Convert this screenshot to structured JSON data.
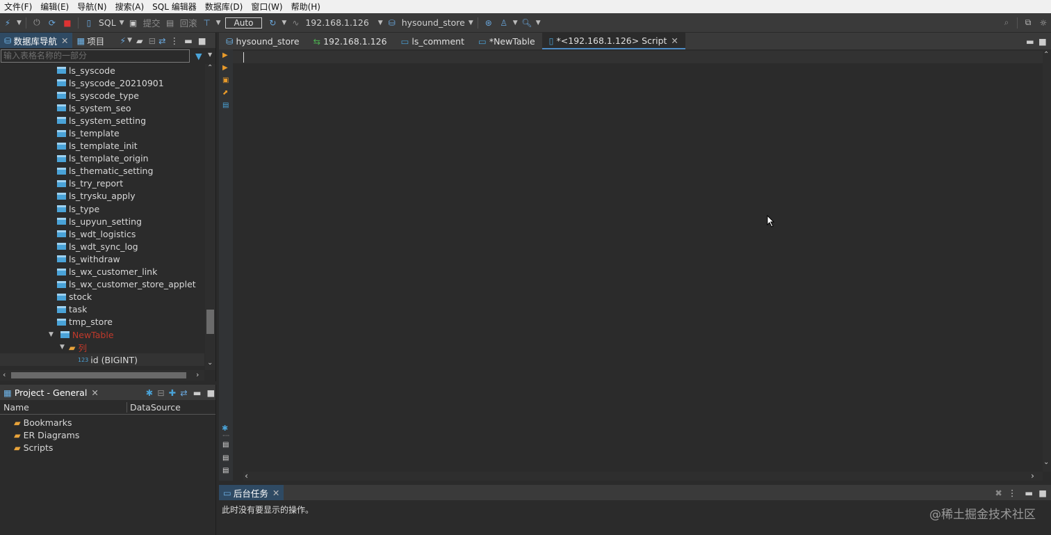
{
  "menu": [
    "文件(F)",
    "编辑(E)",
    "导航(N)",
    "搜索(A)",
    "SQL 编辑器",
    "数据库(D)",
    "窗口(W)",
    "帮助(H)"
  ],
  "toolbar": {
    "sql": "SQL",
    "commit": "提交",
    "rollback": "回滚",
    "mode": "Auto",
    "connection": "192.168.1.126",
    "database": "hysound_store"
  },
  "left_panel": {
    "tab_nav": "数据库导航",
    "tab_project": "项目",
    "filter_placeholder": "输入表格名称的一部分",
    "tables": [
      "ls_syscode",
      "ls_syscode_20210901",
      "ls_syscode_type",
      "ls_system_seo",
      "ls_system_setting",
      "ls_template",
      "ls_template_init",
      "ls_template_origin",
      "ls_thematic_setting",
      "ls_try_report",
      "ls_trysku_apply",
      "ls_type",
      "ls_upyun_setting",
      "ls_wdt_logistics",
      "ls_wdt_sync_log",
      "ls_withdraw",
      "ls_wx_customer_link",
      "ls_wx_customer_store_applet",
      "stock",
      "task",
      "tmp_store"
    ],
    "new_table": "NewTable",
    "folder": "列",
    "column_type": "123",
    "column": "id (BIGINT)"
  },
  "project": {
    "title": "Project - General",
    "col_name": "Name",
    "col_ds": "DataSource",
    "items": [
      "Bookmarks",
      "ER Diagrams",
      "Scripts"
    ]
  },
  "editor_tabs": [
    "hysound_store",
    "192.168.1.126",
    "ls_comment",
    "*NewTable",
    "*<192.168.1.126> Script"
  ],
  "bottom": {
    "title": "后台任务",
    "message": "此时没有要显示的操作。",
    "watermark": "@稀土掘金技术社区"
  }
}
